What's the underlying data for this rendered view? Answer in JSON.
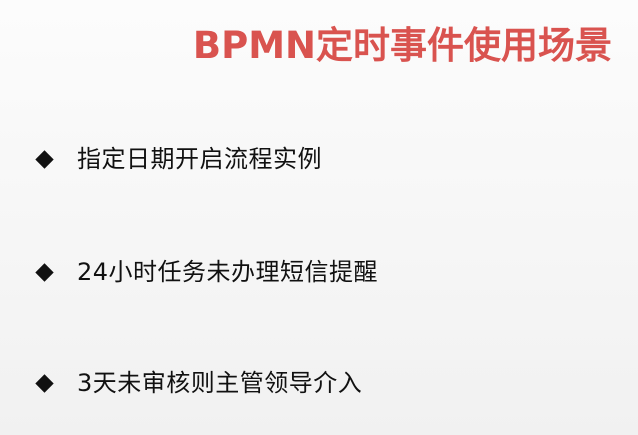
{
  "slide": {
    "title": "BPMN定时事件使用场景",
    "title_color": "#d9534f",
    "bullet_icon": "diamond-bullet-icon",
    "bullets": [
      {
        "text": "指定日期开启流程实例"
      },
      {
        "text": "24小时任务未办理短信提醒"
      },
      {
        "text": "3天未审核则主管领导介入"
      }
    ]
  }
}
